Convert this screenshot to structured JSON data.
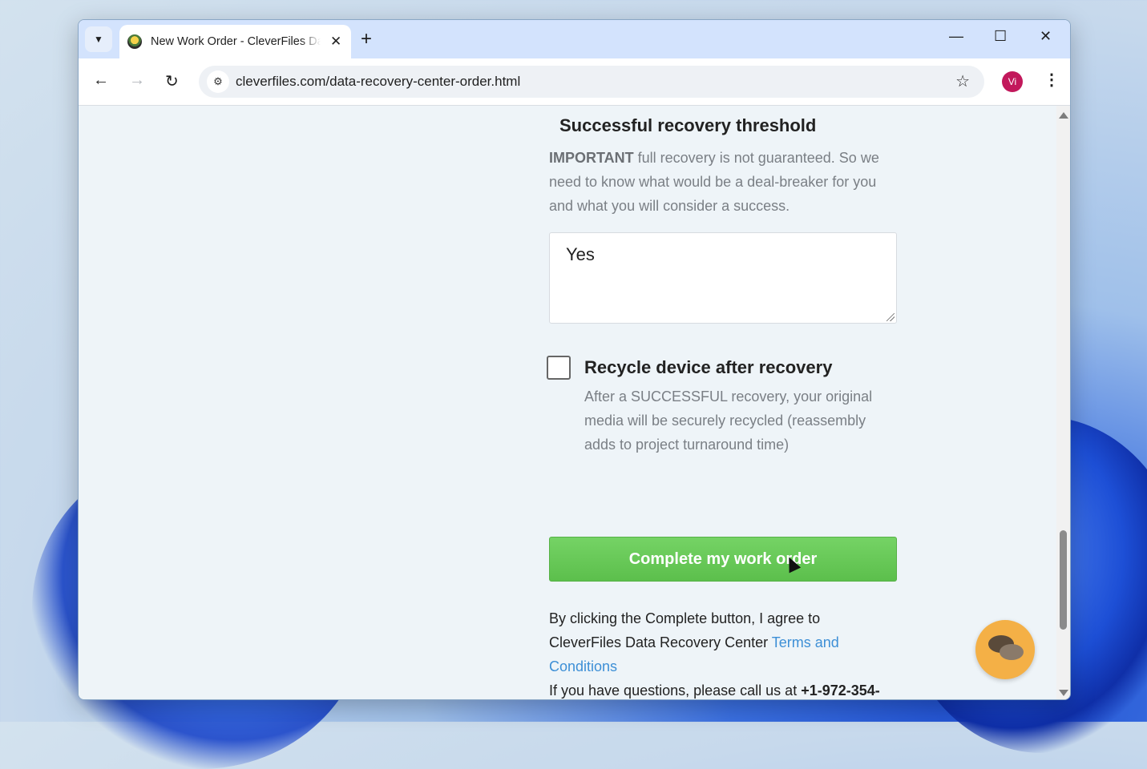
{
  "browser": {
    "tab_title": "New Work Order - CleverFiles Data Recovery Center",
    "url": "cleverfiles.com/data-recovery-center-order.html",
    "profile_initials": "Vi"
  },
  "page": {
    "heading": "Successful recovery threshold",
    "important_strong": "IMPORTANT",
    "important_text": " full recovery is not guaranteed. So we need to know what would be a deal-breaker for you and what you will consider a success.",
    "threshold_value": "Yes",
    "recycle_label": "Recycle device after recovery",
    "recycle_checked": false,
    "recycle_desc": "After a SUCCESSFUL recovery, your original media will be securely recycled (reassembly adds to project turnaround time)",
    "complete_button": "Complete my work order",
    "agree_text": "By clicking the Complete button, I agree to CleverFiles Data Recovery Center ",
    "terms_link": "Terms and Conditions",
    "questions_text": "If you have questions, please call us at ",
    "phone": "+1-972-354-"
  },
  "colors": {
    "accent_green": "#5cbf4c",
    "link_blue": "#3d8fd6",
    "chat_orange": "#f4b046"
  }
}
